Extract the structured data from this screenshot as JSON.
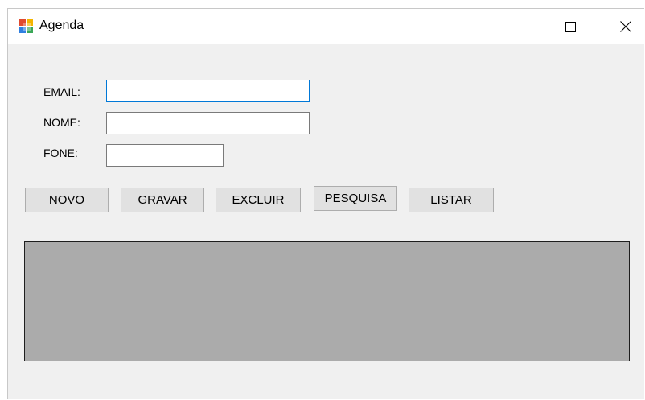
{
  "window": {
    "title": "Agenda",
    "controls": {
      "minimize_icon": "minimize-icon",
      "maximize_icon": "maximize-icon",
      "close_icon": "close-icon"
    }
  },
  "form": {
    "email_label": "EMAIL:",
    "email_value": "",
    "nome_label": "NOME:",
    "nome_value": "",
    "fone_label": "FONE:",
    "fone_value": ""
  },
  "buttons": {
    "novo": "NOVO",
    "gravar": "GRAVAR",
    "excluir": "EXCLUIR",
    "pesquisa": "PESQUISA",
    "listar": "LISTAR"
  },
  "colors": {
    "window_bg": "#f0f0f0",
    "grid_bg": "#ababab",
    "focus_border": "#0078d7"
  }
}
